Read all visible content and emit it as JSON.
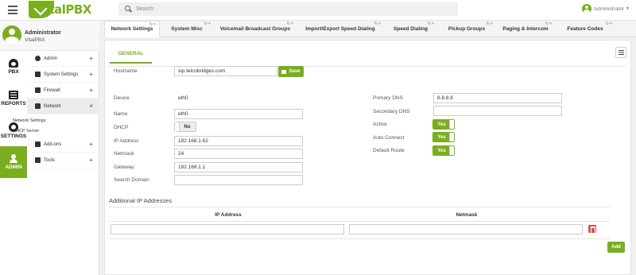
{
  "brand": {
    "name_prefix": "Vital",
    "name_suffix": "PBX"
  },
  "search": {
    "placeholder": "Search"
  },
  "user": {
    "name": "Administrator"
  },
  "profile": {
    "name": "Administrator",
    "org": "VitalPBX"
  },
  "rail": [
    {
      "label": "PBX",
      "icon": "phone-icon"
    },
    {
      "label": "REPORTS",
      "icon": "reports-icon"
    },
    {
      "label": "SETTINGS",
      "icon": "gears-icon"
    },
    {
      "label": "ADMIN",
      "icon": "admin-icon",
      "active": true
    }
  ],
  "submenu": [
    {
      "label": "Admin",
      "mark": "+",
      "icon": "user-icon"
    },
    {
      "label": "System Settings",
      "mark": "+",
      "icon": "monitor-icon"
    },
    {
      "label": "Firewall",
      "mark": "+",
      "icon": "lock-icon"
    },
    {
      "label": "Network",
      "mark": "×",
      "icon": "network-icon",
      "open": true,
      "children": [
        "Network Settings",
        "DHCP Server"
      ]
    },
    {
      "label": "Add-ons",
      "mark": "+",
      "icon": "puzzle-icon"
    },
    {
      "label": "Tools",
      "mark": "+",
      "icon": "briefcase-icon"
    }
  ],
  "tabs": [
    "Network Settings",
    "System Misc",
    "Voicemail Broadcast Groups",
    "Import/Export Speed Dialing",
    "Speed Dialing",
    "Pickup Groups",
    "Paging & Intercom",
    "Feature Codes"
  ],
  "panel": {
    "section_tab": "GENERAL",
    "hostname_label": "Hostname",
    "hostname": "sip.telcobridges.com",
    "save_label": "Save",
    "device_label": "Device",
    "device": "eth0",
    "name_label": "Name",
    "name": "eth0",
    "dhcp_label": "DHCP",
    "dhcp": "No",
    "ip_label": "IP Address",
    "ip": "192.168.1.62",
    "netmask_label": "Netmask",
    "netmask": "24",
    "gateway_label": "Gateway",
    "gateway": "192.168.1.1",
    "search_domain_label": "Search Domain",
    "search_domain": "",
    "primary_dns_label": "Primary DNS",
    "primary_dns": "8.8.8.8",
    "secondary_dns_label": "Secondary DNS",
    "secondary_dns": "",
    "active_label": "Active",
    "active": "Yes",
    "auto_connect_label": "Auto Connect",
    "auto_connect": "Yes",
    "default_route_label": "Default Route",
    "default_route": "Yes"
  },
  "additional_ips": {
    "title": "Additional IP Addresses",
    "headers": [
      "IP Address",
      "Netmask"
    ],
    "rows": [
      {
        "ip": "",
        "netmask": ""
      }
    ],
    "add_label": "Add"
  },
  "colors": {
    "accent": "#7aae1e",
    "danger": "#d9534f"
  }
}
